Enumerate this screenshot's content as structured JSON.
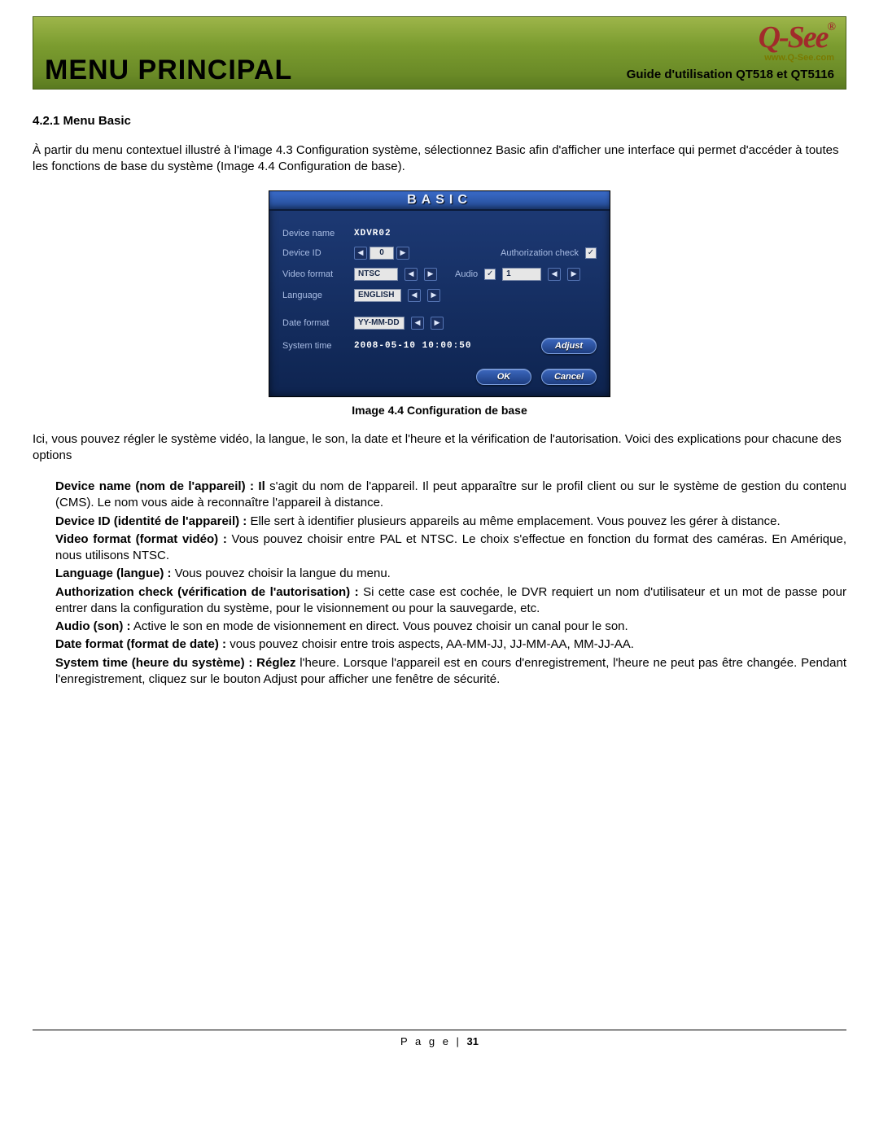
{
  "banner": {
    "title": "MENU PRINCIPAL",
    "subtitle": "Guide d'utilisation QT518 et QT5116",
    "logo_text": "Q-See",
    "logo_reg": "®",
    "logo_url": "www.Q-See.com"
  },
  "section": {
    "heading": "4.2.1 Menu Basic",
    "intro": "À partir du menu contextuel illustré à l'image 4.3 Configuration système, sélectionnez Basic afin d'afficher une interface qui permet d'accéder à toutes les fonctions de base du système (Image 4.4 Configuration de base).",
    "caption": "Image 4.4 Configuration de base",
    "after": "Ici, vous pouvez régler le système vidéo, la langue, le son, la date et l'heure et la vérification de l'autorisation. Voici des explications pour chacune des options"
  },
  "defs": [
    {
      "term": "Device name (nom de l'appareil) : Il",
      "text": " s'agit du nom de l'appareil. Il peut apparaître sur le profil client ou sur le système de gestion du contenu (CMS). Le nom vous aide à reconnaître l'appareil à distance."
    },
    {
      "term": "Device ID (identité de l'appareil) :",
      "text": " Elle sert à identifier plusieurs appareils au même emplacement. Vous pouvez les gérer à distance."
    },
    {
      "term": "Video format (format vidéo) :",
      "text": " Vous pouvez choisir entre PAL et NTSC. Le choix s'effectue en fonction du format des caméras. En Amérique, nous utilisons NTSC."
    },
    {
      "term": "Language (langue) :",
      "text": " Vous pouvez choisir la langue du menu."
    },
    {
      "term": "Authorization check (vérification de l'autorisation) :",
      "text": " Si cette case est cochée, le DVR requiert un nom d'utilisateur et un mot de passe pour entrer dans la configuration du système, pour le visionnement ou pour la sauvegarde, etc."
    },
    {
      "term": "Audio (son) :",
      "text": " Active le son en mode de visionnement en direct. Vous pouvez choisir un canal pour le son."
    },
    {
      "term": "Date format (format de date) :",
      "text": " vous pouvez choisir entre trois aspects, AA-MM-JJ, JJ-MM-AA, MM-JJ-AA."
    },
    {
      "term": "System time (heure du système) : Réglez",
      "text": " l'heure. Lorsque l'appareil est en cours d'enregistrement, l'heure ne peut pas être changée. Pendant l'enregistrement, cliquez sur le bouton Adjust pour afficher une fenêtre de sécurité."
    }
  ],
  "dvr": {
    "title": "BASIC",
    "labels": {
      "device_name": "Device name",
      "device_id": "Device ID",
      "auth_check": "Authorization check",
      "video_format": "Video format",
      "audio": "Audio",
      "language": "Language",
      "date_format": "Date format",
      "system_time": "System time"
    },
    "values": {
      "device_name": "XDVR02",
      "device_id": "0",
      "video_format": "NTSC",
      "audio_channel": "1",
      "language": "ENGLISH",
      "date_format": "YY-MM-DD",
      "system_time": "2008-05-10 10:00:50",
      "auth_checked": "✓",
      "audio_checked": "✓"
    },
    "buttons": {
      "adjust": "Adjust",
      "ok": "OK",
      "cancel": "Cancel"
    },
    "arrow_left": "◀",
    "arrow_right": "▶"
  },
  "footer": {
    "label": "P a g e  |",
    "num": "31"
  }
}
